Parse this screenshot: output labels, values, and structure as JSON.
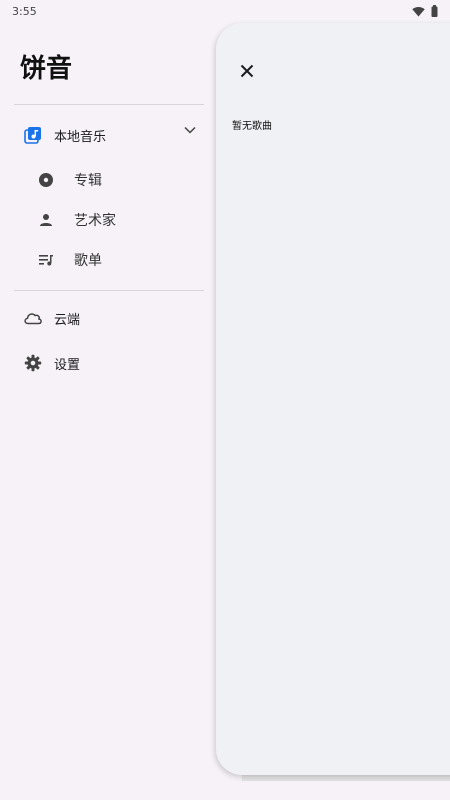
{
  "status_bar": {
    "time": "3:55",
    "wifi_icon": "wifi-icon",
    "battery_icon": "battery-icon"
  },
  "app": {
    "title": "饼音"
  },
  "nav": {
    "local_music": {
      "label": "本地音乐",
      "icon": "library-music-icon",
      "expanded": true
    },
    "sub_items": [
      {
        "label": "专辑",
        "icon": "album-icon"
      },
      {
        "label": "艺术家",
        "icon": "person-icon"
      },
      {
        "label": "歌单",
        "icon": "playlist-icon"
      }
    ],
    "cloud": {
      "label": "云端",
      "icon": "cloud-icon"
    },
    "settings": {
      "label": "设置",
      "icon": "gear-icon"
    }
  },
  "sheet": {
    "empty_text": "暂无歌曲",
    "close_icon": "close-icon"
  },
  "colors": {
    "accent": "#1a73e8",
    "drawer_bg": "#f6f2f8",
    "sheet_bg": "#f0f1f4"
  }
}
